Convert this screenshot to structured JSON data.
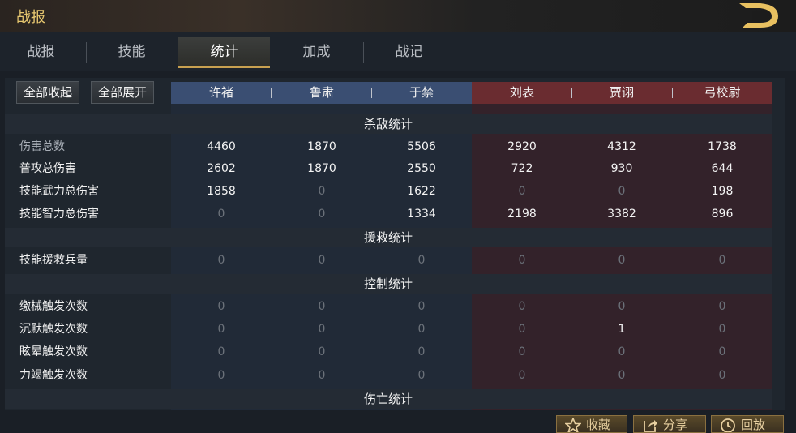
{
  "window": {
    "title": "战报"
  },
  "tabs": [
    "战报",
    "技能",
    "统计",
    "加成",
    "战记"
  ],
  "active_tab": "统计",
  "buttons": {
    "collapse_all": "全部收起",
    "expand_all": "全部展开"
  },
  "generals": [
    "许褚",
    "鲁肃",
    "于禁",
    "刘表",
    "贾诩",
    "弓校尉"
  ],
  "sections": {
    "kill": "杀敌统计",
    "rescue": "援救统计",
    "control": "控制统计",
    "casualty": "伤亡统计"
  },
  "rows": [
    {
      "label": "伤害总数",
      "values": [
        "4460",
        "1870",
        "5506",
        "2920",
        "4312",
        "1738"
      ]
    },
    {
      "label": "普攻总伤害",
      "values": [
        "2602",
        "1870",
        "2550",
        "722",
        "930",
        "644"
      ]
    },
    {
      "label": "技能武力总伤害",
      "values": [
        "1858",
        "0",
        "1622",
        "0",
        "0",
        "198"
      ]
    },
    {
      "label": "技能智力总伤害",
      "values": [
        "0",
        "0",
        "1334",
        "2198",
        "3382",
        "896"
      ]
    },
    {
      "label": "技能援救兵量",
      "values": [
        "0",
        "0",
        "0",
        "0",
        "0",
        "0"
      ]
    },
    {
      "label": "缴械触发次数",
      "values": [
        "0",
        "0",
        "0",
        "0",
        "0",
        "0"
      ]
    },
    {
      "label": "沉默触发次数",
      "values": [
        "0",
        "0",
        "0",
        "0",
        "1",
        "0"
      ]
    },
    {
      "label": "眩晕触发次数",
      "values": [
        "0",
        "0",
        "0",
        "0",
        "0",
        "0"
      ]
    },
    {
      "label": "力竭触发次数",
      "values": [
        "0",
        "0",
        "0",
        "0",
        "0",
        "0"
      ]
    }
  ],
  "bottom_buttons": [
    "收藏",
    "分享",
    "回放"
  ],
  "colors": {
    "ally": "#3a4e72",
    "enemy": "#6a2c30",
    "accent": "#e8c870"
  }
}
